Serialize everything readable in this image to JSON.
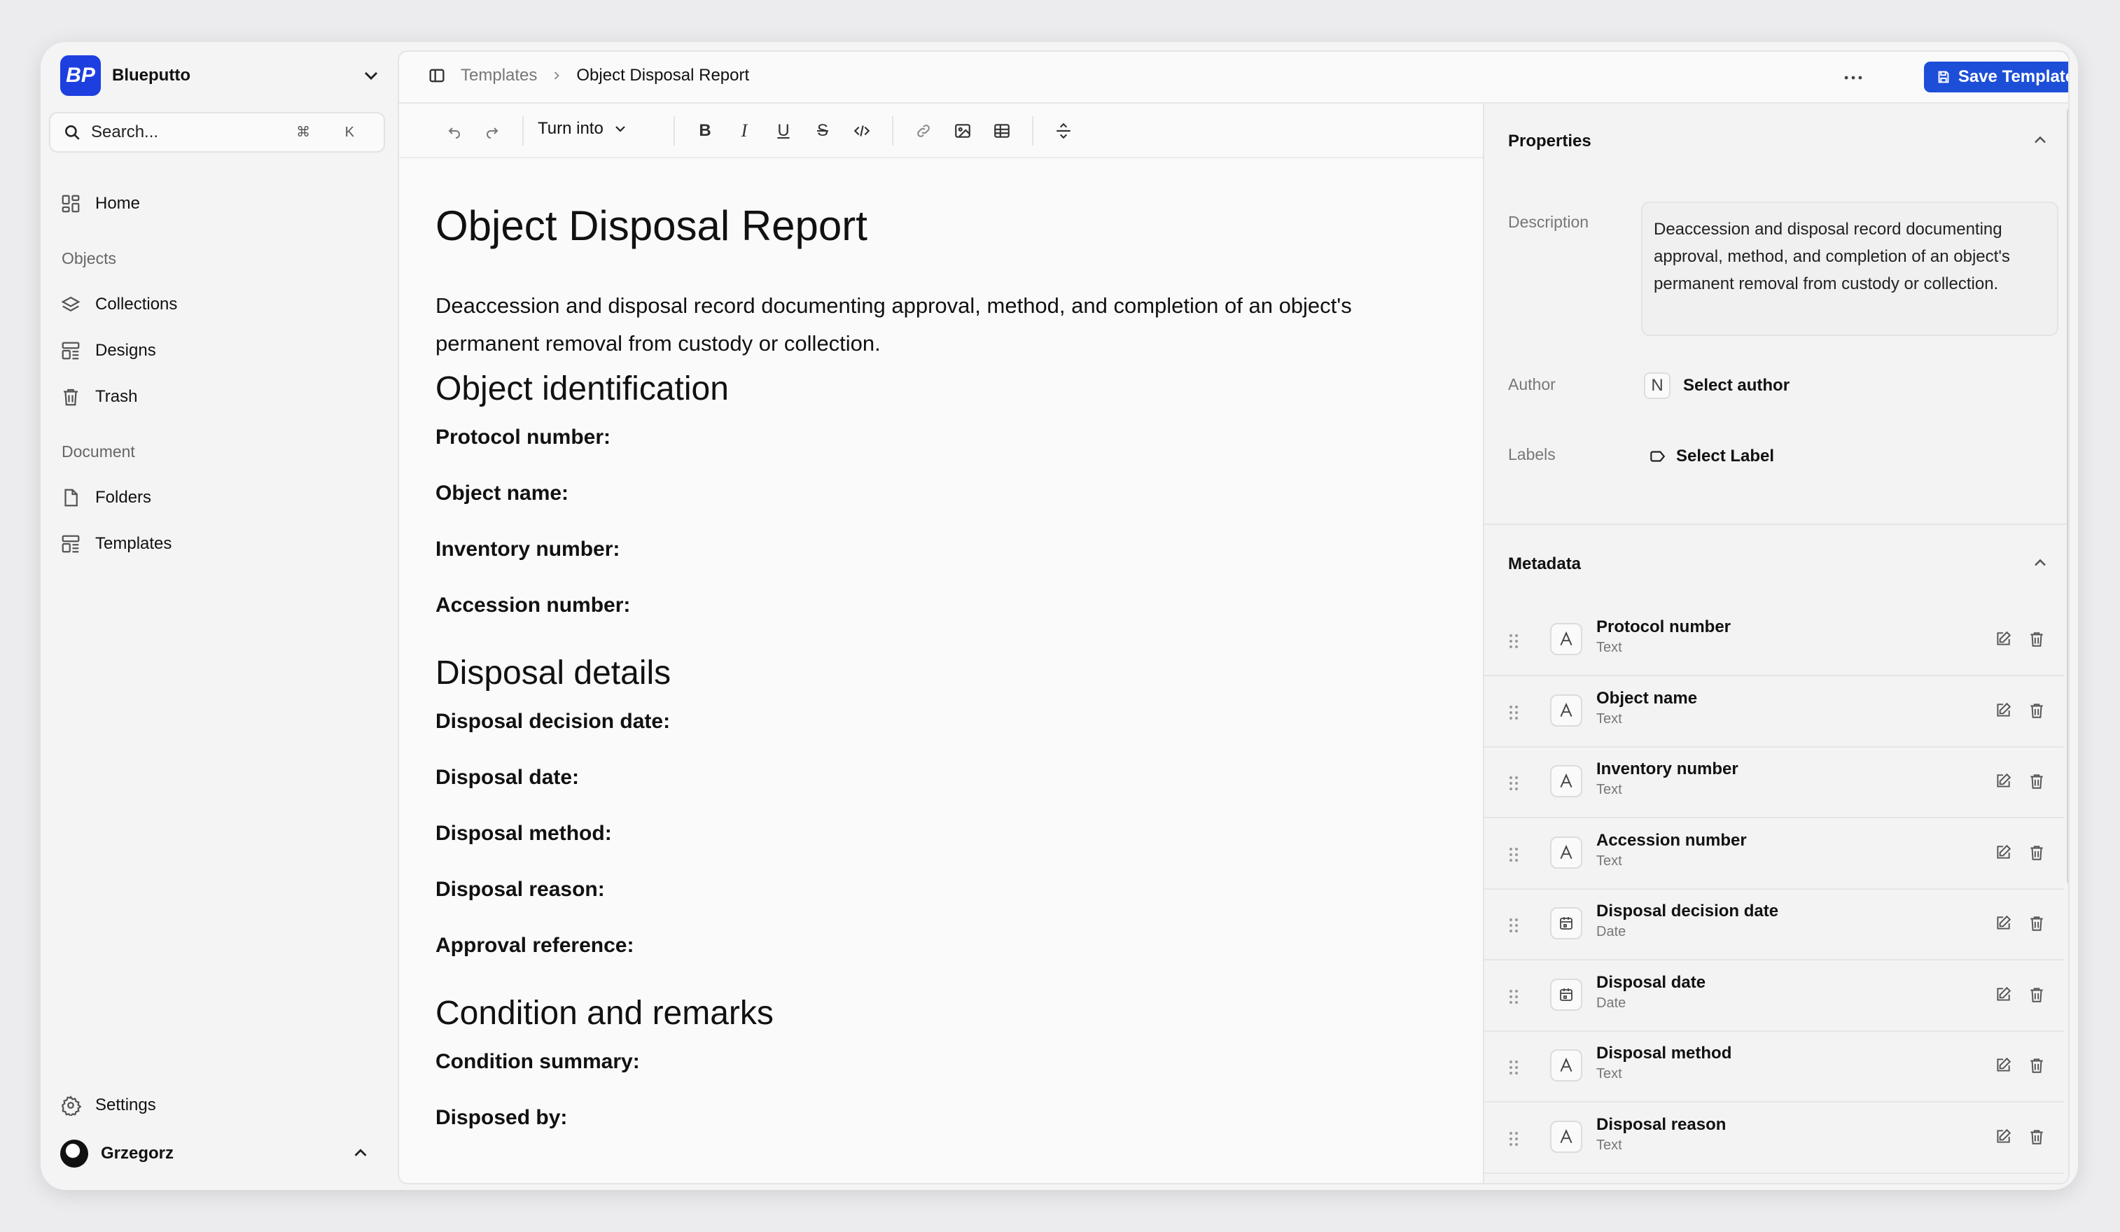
{
  "workspace": {
    "name": "Blueputto",
    "logo_text": "BP"
  },
  "search": {
    "label": "Search...",
    "shortcut": "⌘ K"
  },
  "sidebar": {
    "home": "Home",
    "objects_section": "Objects",
    "collections": "Collections",
    "designs": "Designs",
    "trash": "Trash",
    "document_section": "Document",
    "folders": "Folders",
    "templates": "Templates",
    "settings": "Settings"
  },
  "user": {
    "name": "Grzegorz"
  },
  "breadcrumb": {
    "parent": "Templates",
    "current": "Object Disposal Report"
  },
  "header": {
    "save_label": "Save Template"
  },
  "toolbar": {
    "turn_into": "Turn into",
    "bold": "B",
    "italic": "I",
    "underline": "U",
    "strike": "S"
  },
  "document": {
    "title": "Object Disposal Report",
    "description": "Deaccession and disposal record documenting approval, method, and completion of an object's permanent removal from custody or collection.",
    "sections": [
      {
        "heading": "Object identification",
        "fields": [
          "Protocol number:",
          "Object name:",
          "Inventory number:",
          "Accession number:"
        ]
      },
      {
        "heading": "Disposal details",
        "fields": [
          "Disposal decision date:",
          "Disposal date:",
          "Disposal method:",
          "Disposal reason:",
          "Approval reference:"
        ]
      },
      {
        "heading": "Condition and remarks",
        "fields": [
          "Condition summary:",
          "Disposed by:"
        ]
      }
    ]
  },
  "properties": {
    "title": "Properties",
    "description_label": "Description",
    "description": "Deaccession and disposal record documenting approval, method, and completion of an object's permanent removal from custody or collection.",
    "author_label": "Author",
    "author_initial": "N",
    "author_value": "Select author",
    "labels_label": "Labels",
    "labels_value": "Select Label"
  },
  "metadata": {
    "title": "Metadata",
    "items": [
      {
        "name": "Protocol number",
        "type": "Text",
        "icon": "text-type-icon"
      },
      {
        "name": "Object name",
        "type": "Text",
        "icon": "text-type-icon"
      },
      {
        "name": "Inventory number",
        "type": "Text",
        "icon": "text-type-icon"
      },
      {
        "name": "Accession number",
        "type": "Text",
        "icon": "text-type-icon"
      },
      {
        "name": "Disposal decision date",
        "type": "Date",
        "icon": "calendar-icon"
      },
      {
        "name": "Disposal date",
        "type": "Date",
        "icon": "calendar-icon"
      },
      {
        "name": "Disposal method",
        "type": "Text",
        "icon": "text-type-icon"
      },
      {
        "name": "Disposal reason",
        "type": "Text",
        "icon": "text-type-icon"
      }
    ]
  },
  "colors": {
    "accent": "#1d4ed8",
    "logo": "#1d3fe0"
  }
}
